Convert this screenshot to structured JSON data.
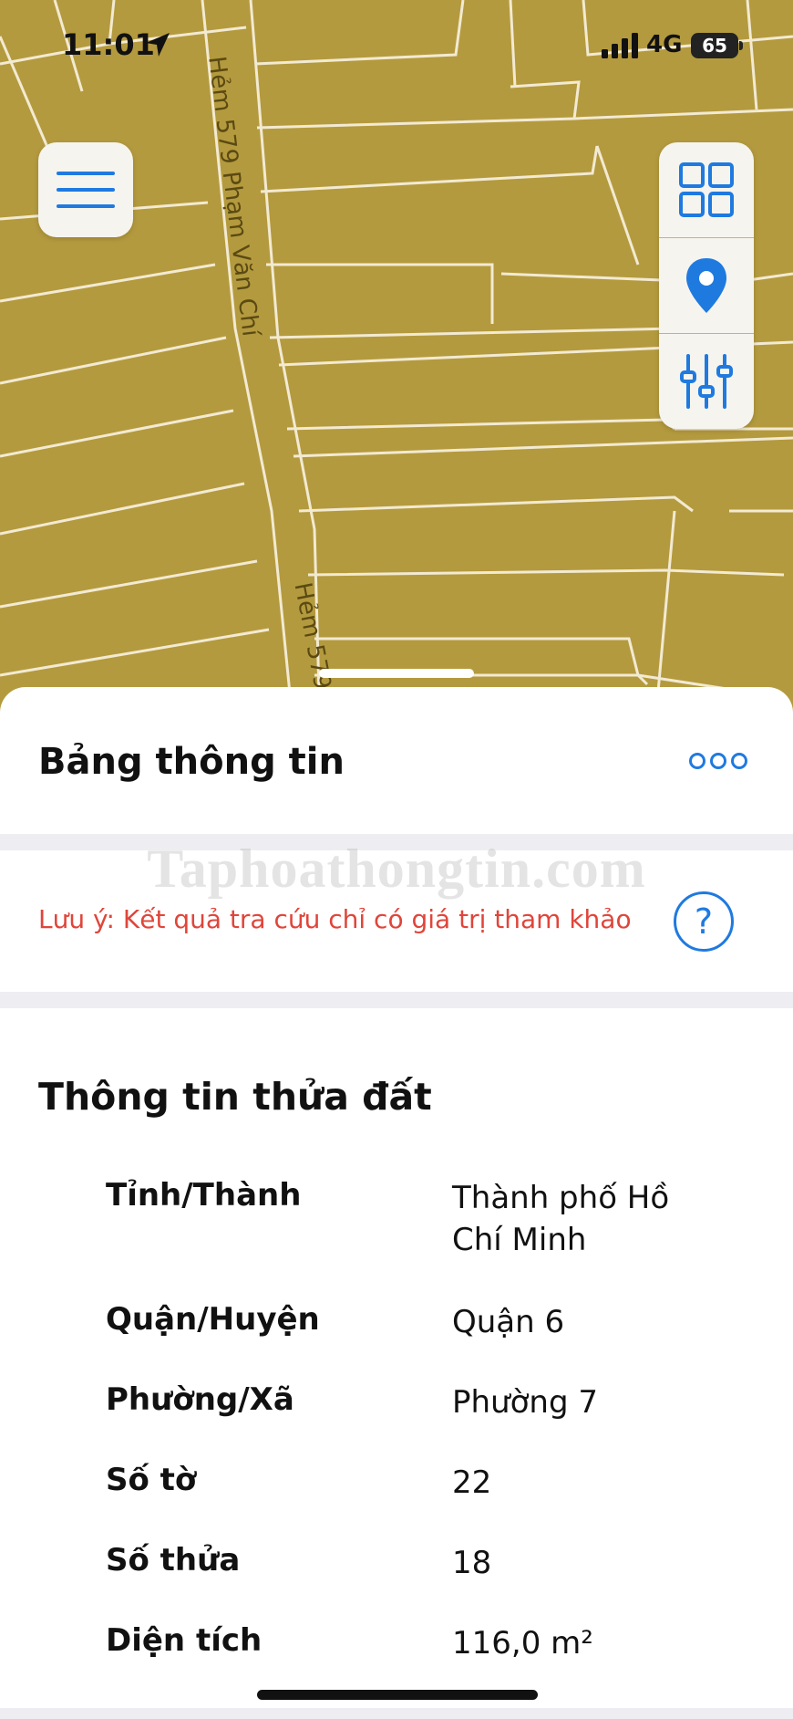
{
  "status_bar": {
    "time": "11:01",
    "network": "4G",
    "battery": "65"
  },
  "map": {
    "road_label_top": "Hẻm 579 Phạm Văn Chí",
    "road_label_bottom": "Hẻm 579",
    "fill_color": "#b49a3e",
    "line_color": "#f2ead2"
  },
  "controls": {
    "menu_icon": "hamburger-icon",
    "tools": [
      "grid-layers-icon",
      "location-pin-icon",
      "sliders-icon"
    ],
    "accent_color": "#1f7ae0"
  },
  "sheet": {
    "title": "Bảng thông tin",
    "watermark": "Taphoathongtin.com",
    "note": "Lưu ý: Kết quả tra cứu chỉ có giá trị tham khảo",
    "help_label": "?",
    "section_title": "Thông tin thửa đất",
    "rows": [
      {
        "label": "Tỉnh/Thành",
        "value": "Thành phố Hồ Chí Minh"
      },
      {
        "label": "Quận/Huyện",
        "value": "Quận 6"
      },
      {
        "label": "Phường/Xã",
        "value": "Phường 7"
      },
      {
        "label": "Số tờ",
        "value": "22"
      },
      {
        "label": "Số thửa",
        "value": "18"
      },
      {
        "label": "Diện tích",
        "value": "116,0 m²"
      }
    ]
  }
}
